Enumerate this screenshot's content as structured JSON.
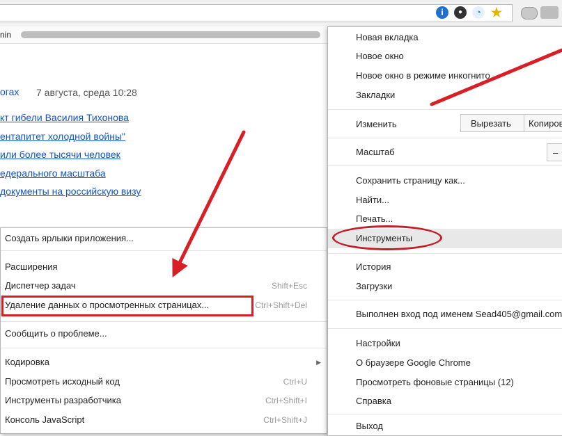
{
  "browser": {
    "bookmark_fragment": "nin"
  },
  "page": {
    "news_title": "огах",
    "news_date": "7 августа, среда 10:28",
    "links": [
      "кт гибели Василия Тихонова",
      "ентапитет холодной войны\"",
      "или более тысячи человек",
      "едерального масштаба",
      "документы на российскую визу"
    ]
  },
  "tools_submenu": {
    "items": [
      {
        "label": "Создать ярлыки приложения...",
        "shortcut": ""
      },
      {
        "label": "Расширения",
        "shortcut": ""
      },
      {
        "label": "Диспетчер задач",
        "shortcut": "Shift+Esc"
      },
      {
        "label": "Удаление данных о просмотренных страницах...",
        "shortcut": "Ctrl+Shift+Del"
      },
      {
        "label": "Сообщить о проблеме...",
        "shortcut": ""
      },
      {
        "label": "Кодировка",
        "shortcut": ""
      },
      {
        "label": "Просмотреть исходный код",
        "shortcut": "Ctrl+U"
      },
      {
        "label": "Инструменты разработчика",
        "shortcut": "Ctrl+Shift+I"
      },
      {
        "label": "Консоль JavaScript",
        "shortcut": "Ctrl+Shift+J"
      }
    ]
  },
  "main_menu": {
    "new_tab": "Новая вкладка",
    "new_window": "Новое окно",
    "incognito": "Новое окно в режиме инкогнито",
    "bookmarks": "Закладки",
    "edit": "Изменить",
    "cut": "Вырезать",
    "copy": "Копировать",
    "zoom": "Масштаб",
    "zoom_minus": "–",
    "save_page": "Сохранить страницу как...",
    "find": "Найти...",
    "print": "Печать...",
    "tools": "Инструменты",
    "history": "История",
    "downloads": "Загрузки",
    "signed_in": "Выполнен вход под именем Sead405@gmail.com",
    "settings": "Настройки",
    "about": "О браузере Google Chrome",
    "background_pages": "Просмотреть фоновые страницы (12)",
    "help": "Справка",
    "exit": "Выход"
  },
  "colors": {
    "annotation_red": "#d81f26",
    "link_blue": "#1155cc"
  }
}
